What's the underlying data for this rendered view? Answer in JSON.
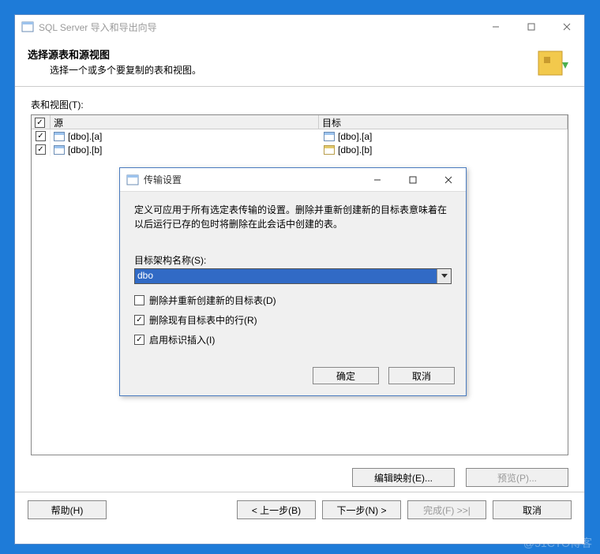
{
  "mainWindow": {
    "title": "SQL Server 导入和导出向导",
    "headerTitle": "选择源表和源视图",
    "headerSub": "选择一个或多个要复制的表和视图。",
    "tablesLabel": "表和视图(T):",
    "columns": {
      "source": "源",
      "target": "目标"
    },
    "rows": [
      {
        "source": "[dbo].[a]",
        "target": "[dbo].[a]",
        "targetIconYellow": false
      },
      {
        "source": "[dbo].[b]",
        "target": "[dbo].[b]",
        "targetIconYellow": true
      }
    ],
    "editMap": "编辑映射(E)...",
    "preview": "预览(P)...",
    "help": "帮助(H)",
    "back": "< 上一步(B)",
    "next": "下一步(N) >",
    "finish": "完成(F) >>|",
    "cancel": "取消"
  },
  "modal": {
    "title": "传输设置",
    "desc": "定义可应用于所有选定表传输的设置。删除并重新创建新的目标表意味着在以后运行已存的包时将删除在此会话中创建的表。",
    "schemaLabel": "目标架构名称(S):",
    "schemaValue": "dbo",
    "opt1": "删除并重新创建新的目标表(D)",
    "opt2": "删除现有目标表中的行(R)",
    "opt3": "启用标识插入(I)",
    "ok": "确定",
    "cancel": "取消"
  },
  "watermark": "@51CTO博客"
}
